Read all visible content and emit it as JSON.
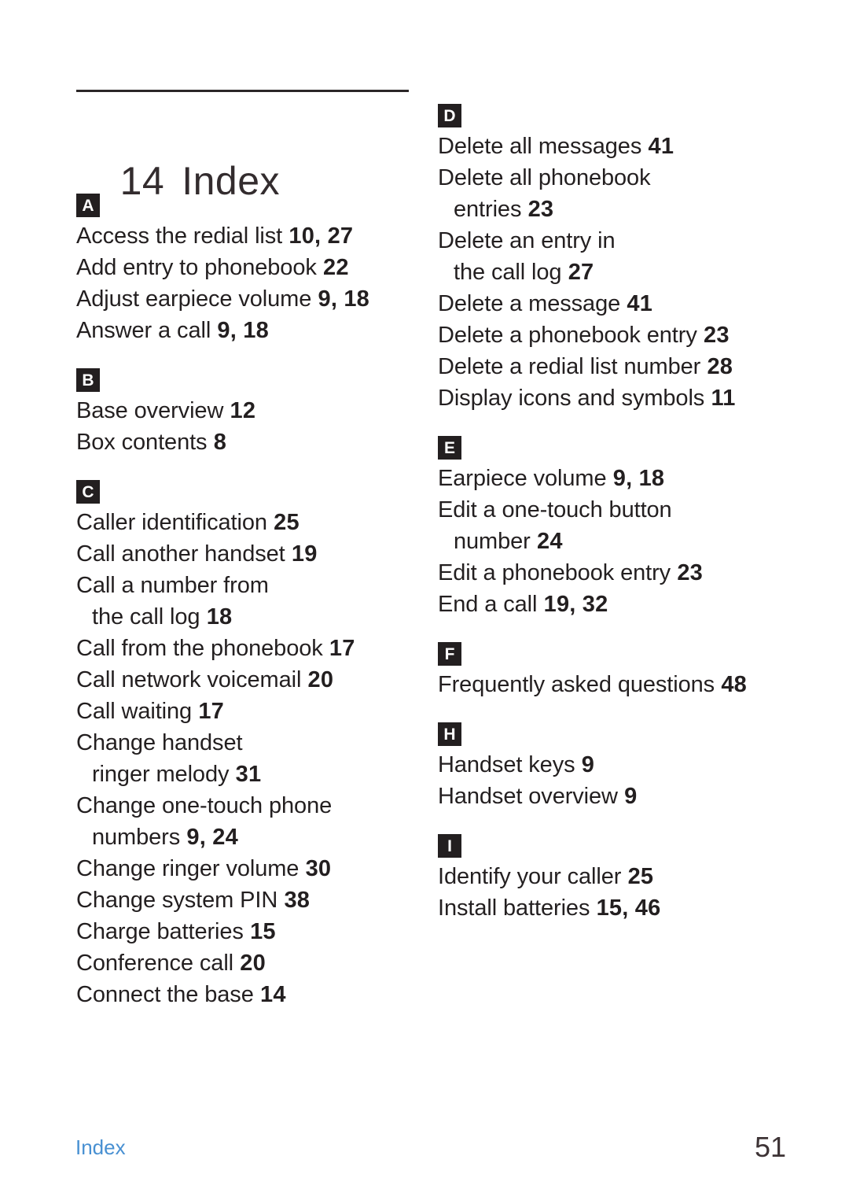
{
  "document": {
    "chapter_number": "14",
    "title": "Index",
    "footer_label": "Index",
    "page_number": "51",
    "accent_color": "#4890d2",
    "badge_color": "#231f20",
    "text_color": "#231f20"
  },
  "columns": [
    {
      "name": "left-column",
      "sections": [
        {
          "letter": "A",
          "entries": [
            {
              "text": "Access the redial list",
              "pages": "10, 27",
              "continuation": false
            },
            {
              "text": "Add entry to phonebook",
              "pages": "22",
              "continuation": false
            },
            {
              "text": "Adjust earpiece volume",
              "pages": "9, 18",
              "continuation": false
            },
            {
              "text": "Answer a call",
              "pages": "9, 18",
              "continuation": false
            }
          ]
        },
        {
          "letter": "B",
          "entries": [
            {
              "text": "Base overview",
              "pages": "12",
              "continuation": false
            },
            {
              "text": "Box contents",
              "pages": "8",
              "continuation": false
            }
          ]
        },
        {
          "letter": "C",
          "entries": [
            {
              "text": "Caller identification",
              "pages": "25",
              "continuation": false
            },
            {
              "text": "Call another handset",
              "pages": "19",
              "continuation": false
            },
            {
              "text": "Call a number from",
              "pages": "",
              "continuation": false
            },
            {
              "text": "the call log",
              "pages": "18",
              "continuation": true
            },
            {
              "text": "Call from the phonebook",
              "pages": "17",
              "continuation": false
            },
            {
              "text": "Call network voicemail",
              "pages": "20",
              "continuation": false
            },
            {
              "text": "Call waiting",
              "pages": "17",
              "continuation": false
            },
            {
              "text": "Change handset",
              "pages": "",
              "continuation": false
            },
            {
              "text": "ringer melody",
              "pages": "31",
              "continuation": true
            },
            {
              "text": "Change one-touch phone",
              "pages": "",
              "continuation": false
            },
            {
              "text": "numbers",
              "pages": "9, 24",
              "continuation": true
            },
            {
              "text": "Change ringer volume",
              "pages": "30",
              "continuation": false
            },
            {
              "text": "Change system PIN",
              "pages": "38",
              "continuation": false
            },
            {
              "text": "Charge batteries",
              "pages": "15",
              "continuation": false
            },
            {
              "text": "Conference call",
              "pages": "20",
              "continuation": false
            },
            {
              "text": "Connect the base",
              "pages": "14",
              "continuation": false
            }
          ]
        }
      ]
    },
    {
      "name": "right-column",
      "sections": [
        {
          "letter": "D",
          "entries": [
            {
              "text": "Delete all messages",
              "pages": "41",
              "continuation": false
            },
            {
              "text": "Delete all phonebook",
              "pages": "",
              "continuation": false
            },
            {
              "text": "entries",
              "pages": "23",
              "continuation": true
            },
            {
              "text": "Delete an entry in",
              "pages": "",
              "continuation": false
            },
            {
              "text": "the call log",
              "pages": "27",
              "continuation": true
            },
            {
              "text": "Delete a message",
              "pages": "41",
              "continuation": false
            },
            {
              "text": "Delete a phonebook entry",
              "pages": "23",
              "continuation": false
            },
            {
              "text": "Delete a redial list number",
              "pages": "28",
              "continuation": false
            },
            {
              "text": "Display icons and symbols",
              "pages": "11",
              "continuation": false
            }
          ]
        },
        {
          "letter": "E",
          "entries": [
            {
              "text": "Earpiece volume",
              "pages": "9, 18",
              "continuation": false
            },
            {
              "text": "Edit a one-touch button",
              "pages": "",
              "continuation": false
            },
            {
              "text": "number",
              "pages": "24",
              "continuation": true
            },
            {
              "text": "Edit a phonebook entry",
              "pages": "23",
              "continuation": false
            },
            {
              "text": "End a call",
              "pages": "19, 32",
              "continuation": false
            }
          ]
        },
        {
          "letter": "F",
          "entries": [
            {
              "text": "Frequently asked questions",
              "pages": "48",
              "continuation": false
            }
          ]
        },
        {
          "letter": "H",
          "entries": [
            {
              "text": "Handset keys",
              "pages": "9",
              "continuation": false
            },
            {
              "text": "Handset overview",
              "pages": "9",
              "continuation": false
            }
          ]
        },
        {
          "letter": "I",
          "entries": [
            {
              "text": "Identify your caller",
              "pages": "25",
              "continuation": false
            },
            {
              "text": "Install batteries",
              "pages": "15, 46",
              "continuation": false
            }
          ]
        }
      ]
    }
  ]
}
